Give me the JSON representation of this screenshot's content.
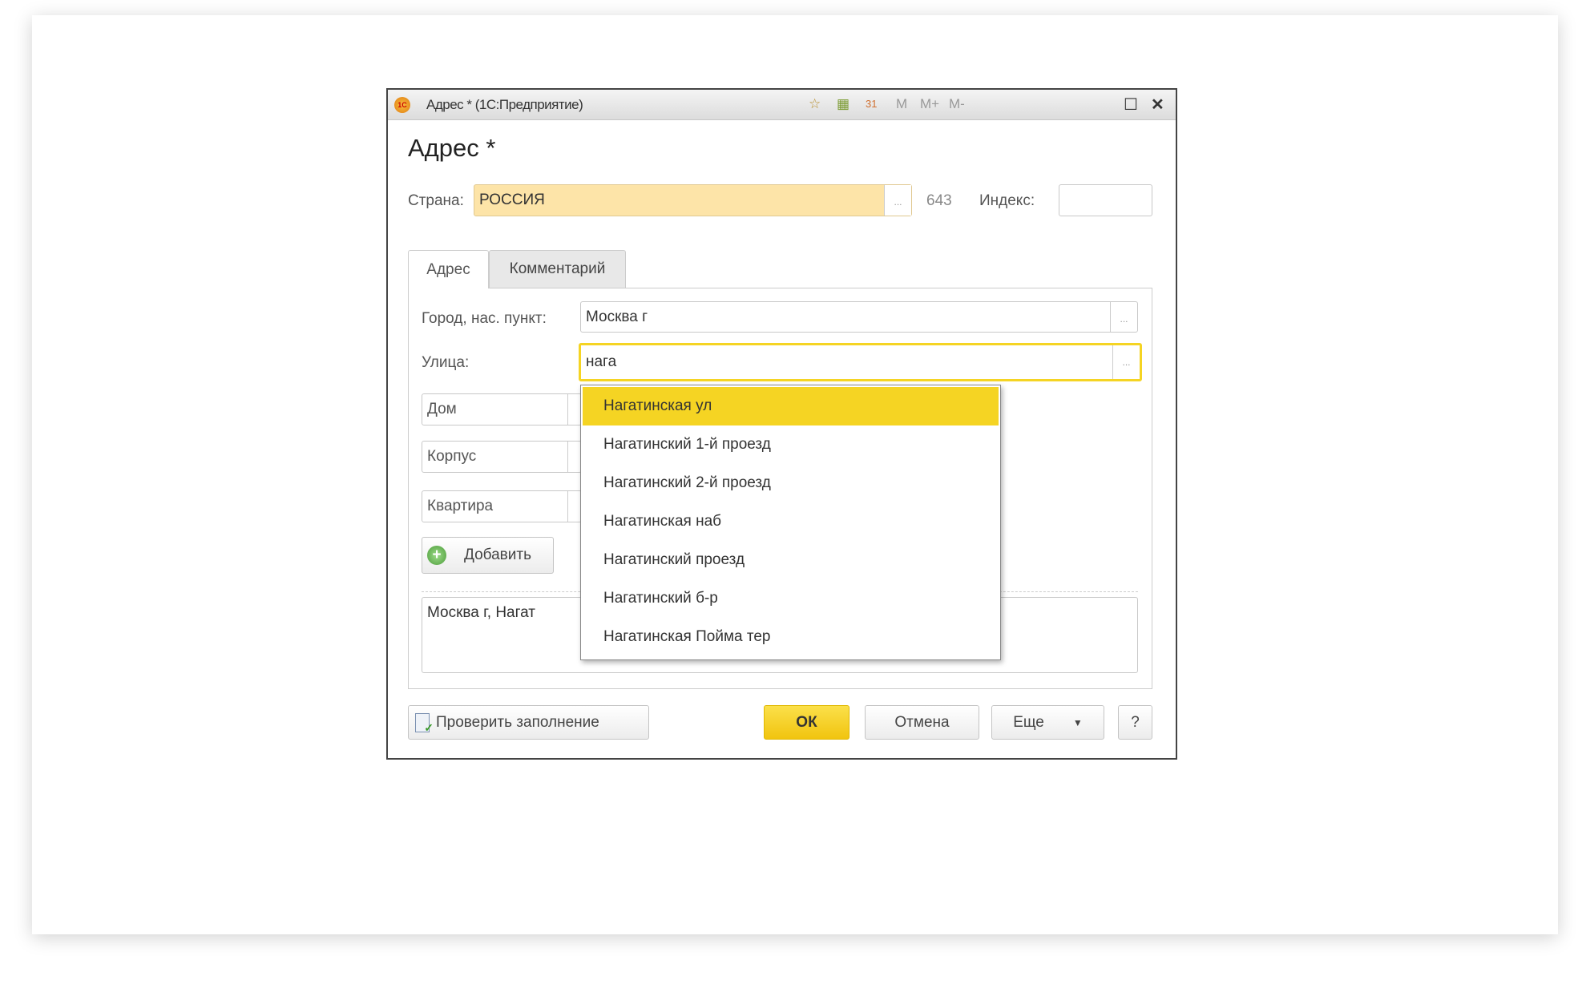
{
  "window": {
    "title": "Адрес * (1С:Предприятие)",
    "logo_text": "1С",
    "toolbar_icons": [
      "favorite-icon",
      "calculator-icon",
      "calendar-icon"
    ],
    "memory": [
      "M",
      "M+",
      "M-"
    ],
    "maximize": "☐",
    "close": "✕"
  },
  "form": {
    "heading": "Адрес *",
    "country": {
      "label": "Страна:",
      "value": "РОССИЯ",
      "code": "643"
    },
    "index": {
      "label": "Индекс:",
      "value": ""
    },
    "tabs": [
      {
        "label": "Адрес",
        "active": true
      },
      {
        "label": "Комментарий",
        "active": false
      }
    ],
    "city": {
      "label": "Город, нас. пункт:",
      "value": "Москва г"
    },
    "street": {
      "label": "Улица:",
      "value": "нага"
    },
    "house": {
      "label": "Дом"
    },
    "building": {
      "label": "Корпус"
    },
    "apartment": {
      "label": "Квартира"
    },
    "add_button": "Добавить",
    "address_text": "Москва г, Нагат",
    "ellipsis": "..."
  },
  "dropdown": {
    "items": [
      "Нагатинская ул",
      "Нагатинский 1-й проезд",
      "Нагатинский 2-й проезд",
      "Нагатинская наб",
      "Нагатинский проезд",
      "Нагатинский б-р",
      "Нагатинская Пойма тер"
    ],
    "selected_index": 0
  },
  "footer": {
    "check": "Проверить заполнение",
    "ok": "ОК",
    "cancel": "Отмена",
    "more": "Еще",
    "help": "?"
  },
  "colors": {
    "accent": "#f5d423",
    "country_bg": "#fde4a8"
  }
}
